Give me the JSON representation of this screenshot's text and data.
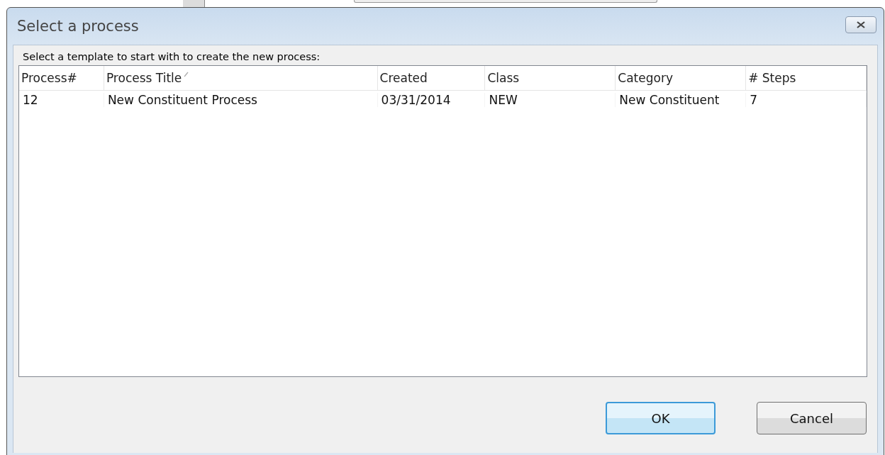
{
  "window": {
    "title": "Select a process"
  },
  "instruction": "Select a template to start with to create the new process:",
  "table": {
    "columns": [
      {
        "label": "Process#",
        "sorted": false
      },
      {
        "label": "Process Title",
        "sorted": true
      },
      {
        "label": "Created",
        "sorted": false
      },
      {
        "label": "Class",
        "sorted": false
      },
      {
        "label": "Category",
        "sorted": false
      },
      {
        "label": "# Steps",
        "sorted": false
      }
    ],
    "rows": [
      {
        "cells": [
          "12",
          "New Constituent Process",
          "03/31/2014",
          "NEW",
          "New Constituent",
          "7"
        ],
        "selected": false
      }
    ]
  },
  "buttons": [
    {
      "label": "OK",
      "default": true
    },
    {
      "label": "Cancel",
      "default": false
    }
  ]
}
